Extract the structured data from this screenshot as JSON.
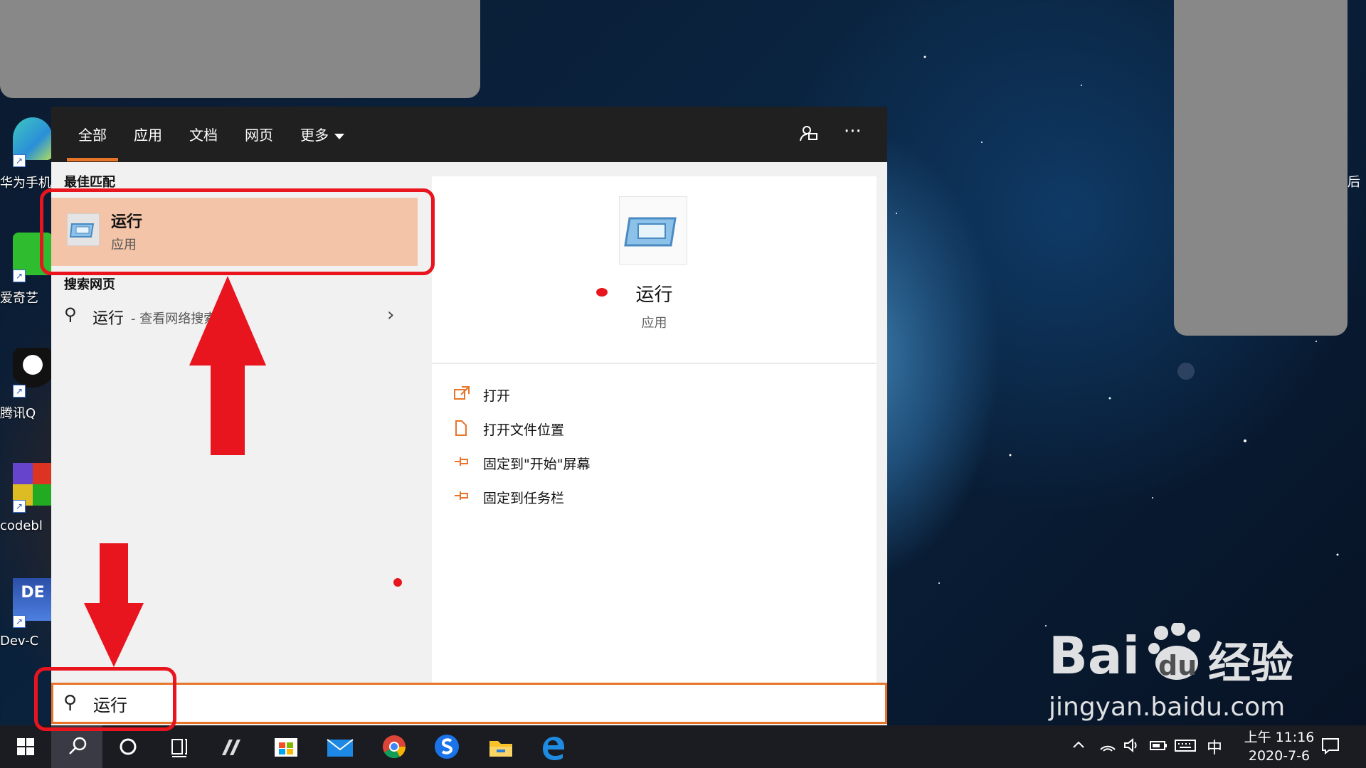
{
  "desktop": {
    "icons": [
      {
        "label": "华为手机"
      },
      {
        "label": "爱奇艺"
      },
      {
        "label": "腾讯Q"
      },
      {
        "label": "codebl"
      },
      {
        "label": "Dev-C"
      }
    ],
    "edge_text": "后"
  },
  "search_panel": {
    "scope_tabs": [
      {
        "label": "全部"
      },
      {
        "label": "应用"
      },
      {
        "label": "文档"
      },
      {
        "label": "网页"
      },
      {
        "label": "更多"
      }
    ],
    "feedback_icon": "feedback-icon",
    "more_options_glyph": "···",
    "best_match": {
      "heading": "最佳匹配",
      "title": "运行",
      "subtitle": "应用"
    },
    "web_search": {
      "heading": "搜索网页",
      "title": "运行",
      "subtitle": "- 查看网络搜索结果"
    },
    "preview": {
      "title": "运行",
      "subtitle": "应用"
    },
    "actions": [
      {
        "label": "打开",
        "icon": "open-icon"
      },
      {
        "label": "打开文件位置",
        "icon": "file-location-icon"
      },
      {
        "label": "固定到\"开始\"屏幕",
        "icon": "pin-icon"
      },
      {
        "label": "固定到任务栏",
        "icon": "pin-icon"
      }
    ],
    "search_box": {
      "value": "运行"
    }
  },
  "taskbar": {
    "clock_time": "上午 11:16",
    "clock_date": "2020-7-6",
    "ime": "中"
  },
  "watermark": {
    "brand": "Bai",
    "brand_mid": "du",
    "brand_cn": "经验",
    "url": "jingyan.baidu.com"
  },
  "colors": {
    "accent": "#e8742a",
    "selection": "#f4c4a8",
    "annotation": "#e8141e"
  }
}
